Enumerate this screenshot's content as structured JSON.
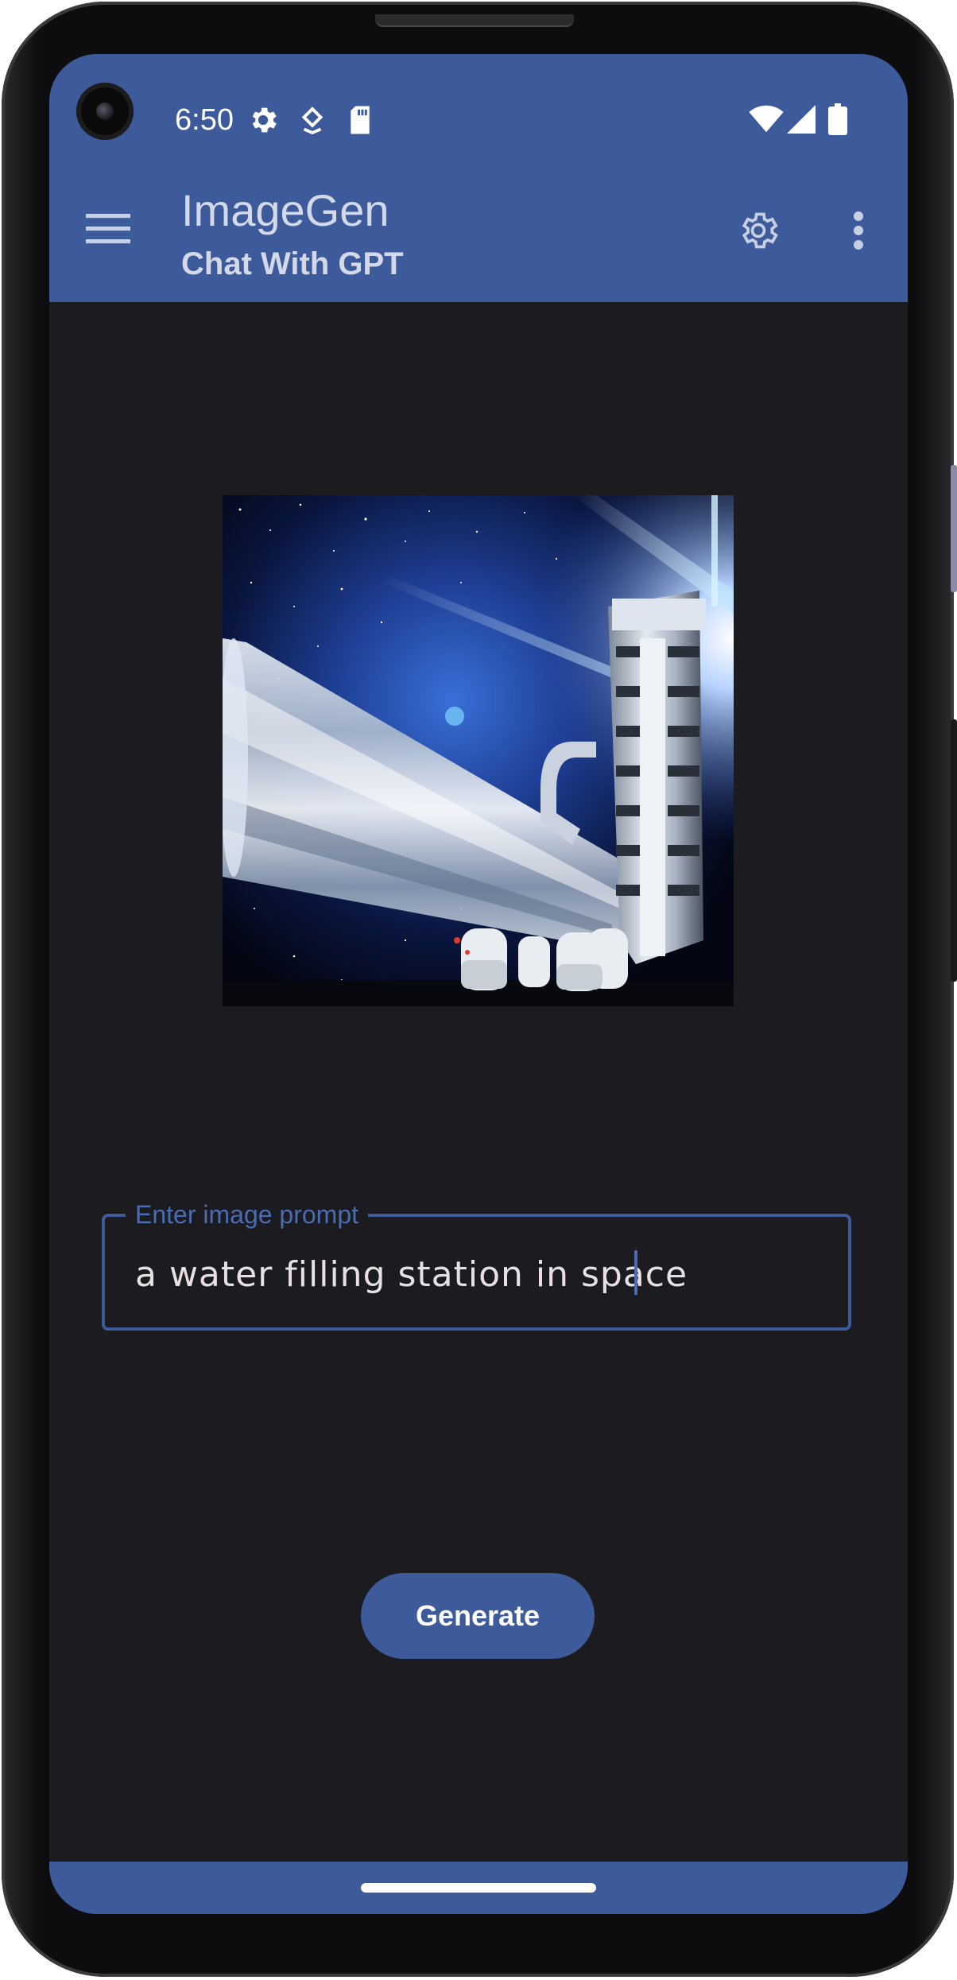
{
  "status_bar": {
    "time": "6:50",
    "icons_left": [
      "gear-icon",
      "location-icon",
      "sd-card-icon"
    ],
    "icons_right": [
      "wifi-icon",
      "cell-signal-icon",
      "battery-icon"
    ]
  },
  "app_bar": {
    "title": "ImageGen",
    "subtitle": "Chat With GPT",
    "actions": [
      "menu-icon",
      "settings-icon",
      "more-vert-icon"
    ]
  },
  "image": {
    "subject": "a water filling station in space"
  },
  "prompt": {
    "label": "Enter image prompt",
    "value": "a water filling station in space"
  },
  "generate_button": {
    "label": "Generate"
  },
  "colors": {
    "primary": "#3d5a9a",
    "background": "#1c1b1f",
    "on_primary": "#ffffff",
    "label": "#4a6cb3"
  }
}
